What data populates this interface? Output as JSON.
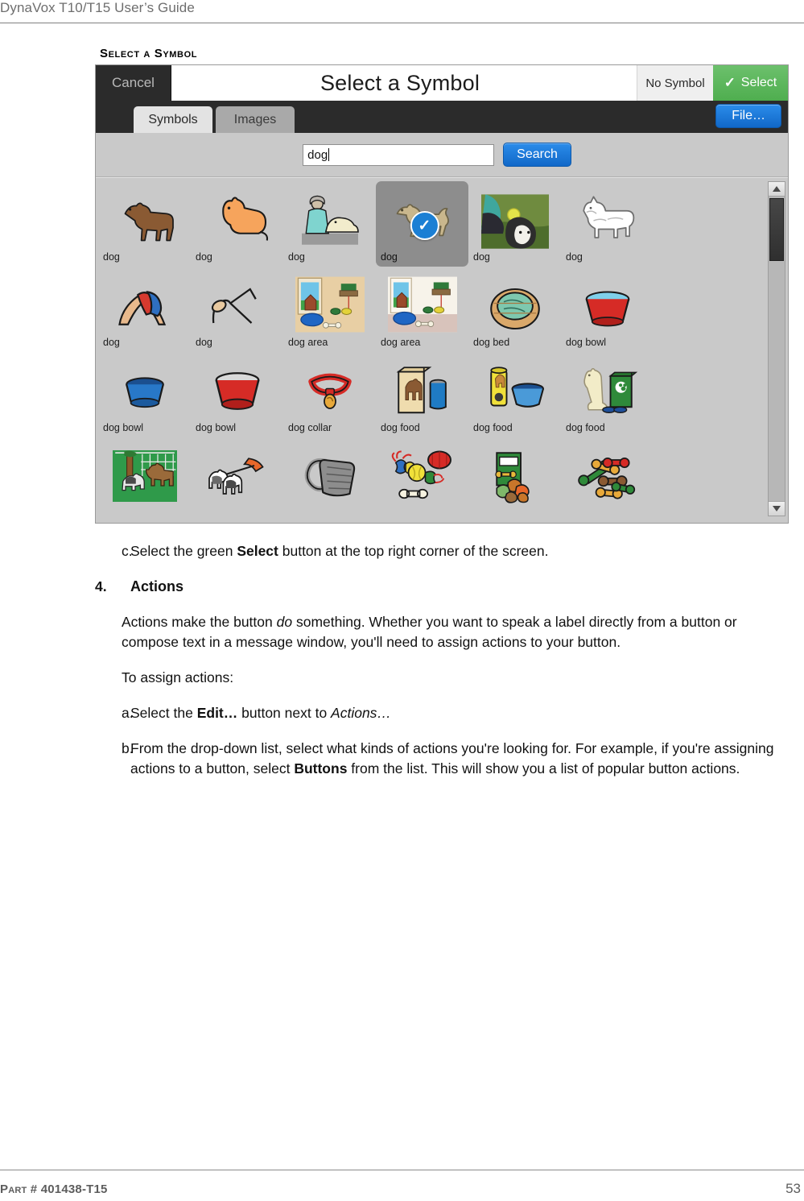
{
  "page": {
    "running_head": "DynaVox T10/T15 User’s Guide",
    "section_heading": "Select a Symbol",
    "footer_left": "Part # 401438-T15",
    "footer_right": "53"
  },
  "screenshot": {
    "titlebar": {
      "cancel_label": "Cancel",
      "title": "Select a Symbol",
      "no_symbol_label": "No Symbol",
      "select_label": "Select",
      "select_check_glyph": "✓",
      "select_color": "#5cb85c"
    },
    "tabs": [
      {
        "label": "Symbols",
        "active": true
      },
      {
        "label": "Images",
        "active": false
      }
    ],
    "file_button_label": "File…",
    "search": {
      "value": "dog",
      "placeholder": "",
      "button_label": "Search",
      "button_color": "#1168c8"
    },
    "results": {
      "rows": [
        [
          {
            "label": "dog",
            "art": "dog-standing-brown",
            "selected": false
          },
          {
            "label": "dog",
            "art": "dog-sitting-orange",
            "selected": false
          },
          {
            "label": "dog",
            "art": "woman-with-dog",
            "selected": false
          },
          {
            "label": "dog",
            "art": "dog-running-tan",
            "selected": true
          },
          {
            "label": "dog",
            "art": "photo-dog-with-ball",
            "selected": false
          },
          {
            "label": "dog",
            "art": "dog-terrier-gray",
            "selected": false
          }
        ],
        [
          {
            "label": "dog",
            "art": "downward-dog-pose",
            "selected": false
          },
          {
            "label": "dog",
            "art": "dog-line-drawing",
            "selected": false
          },
          {
            "label": "dog area",
            "art": "room-with-dog-bed-blue",
            "selected": false
          },
          {
            "label": "dog area",
            "art": "room-with-dog-bed-white",
            "selected": false
          },
          {
            "label": "dog bed",
            "art": "wicker-dog-bed",
            "selected": false
          },
          {
            "label": "dog bowl",
            "art": "red-water-bowl",
            "selected": false
          }
        ],
        [
          {
            "label": "dog bowl",
            "art": "blue-dog-bowl",
            "selected": false
          },
          {
            "label": "dog bowl",
            "art": "red-dog-bowl",
            "selected": false
          },
          {
            "label": "dog collar",
            "art": "red-collar-with-tag",
            "selected": false
          },
          {
            "label": "dog food",
            "art": "food-bag-and-can",
            "selected": false
          },
          {
            "label": "dog food",
            "art": "food-can-and-bowl",
            "selected": false
          },
          {
            "label": "dog food",
            "art": "dog-with-food-bag",
            "selected": false
          }
        ],
        [
          {
            "label": "",
            "art": "dogs-in-fenced-yard",
            "selected": false
          },
          {
            "label": "",
            "art": "dogs-on-leash",
            "selected": false
          },
          {
            "label": "",
            "art": "pooper-scooper",
            "selected": false
          },
          {
            "label": "",
            "art": "dog-toys-ball-rope-bone",
            "selected": false
          },
          {
            "label": "",
            "art": "treat-box-and-biscuits",
            "selected": false
          },
          {
            "label": "",
            "art": "colored-dog-bones",
            "selected": false
          }
        ]
      ],
      "scrollbar": {
        "up_arrow": "▲",
        "down_arrow": "▼",
        "thumb_position": "top"
      }
    }
  },
  "body": {
    "step_c": {
      "marker": "c.",
      "part1": "Select the green ",
      "bold1": "Select",
      "part2": " button at the top right corner of the screen."
    },
    "step_4": {
      "marker": "4.",
      "text": "Actions"
    },
    "para_actions": {
      "part1": "Actions make the button ",
      "italic1": "do",
      "part2": " something. Whether you want to speak a label directly from a button or compose text in a message window, you'll need to assign actions to your button."
    },
    "para_assign": "To assign actions:",
    "step_a": {
      "marker": "a.",
      "part1": "Select the ",
      "bold1": "Edit…",
      "part2": " button next to ",
      "italic1": "Actions…"
    },
    "step_b": {
      "marker": "b.",
      "part1": "From the drop-down list, select what kinds of actions you're looking for. For example, if you're assigning actions to a button, select ",
      "bold1": "Buttons",
      "part2": " from the list. This will show you a list of popular button actions."
    }
  }
}
